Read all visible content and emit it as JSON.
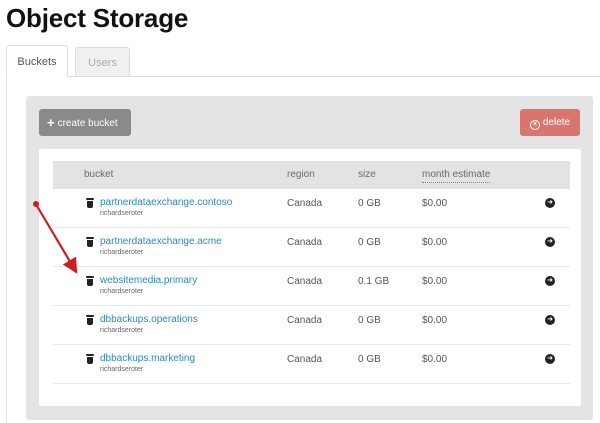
{
  "page": {
    "title": "Object Storage"
  },
  "tabs": [
    {
      "label": "Buckets",
      "active": true
    },
    {
      "label": "Users",
      "active": false
    }
  ],
  "toolbar": {
    "create_label": "create bucket",
    "create_icon": "plus-icon",
    "delete_label": "delete",
    "delete_icon": "close-circle-icon"
  },
  "table": {
    "columns": {
      "bucket": "bucket",
      "region": "region",
      "size": "size",
      "month": "month estimate"
    },
    "rows": [
      {
        "name": "partnerdataexchange.contoso",
        "owner": "richardseroter",
        "region": "Canada",
        "size": "0 GB",
        "estimate": "$0.00"
      },
      {
        "name": "partnerdataexchange.acme",
        "owner": "richardseroter",
        "region": "Canada",
        "size": "0 GB",
        "estimate": "$0.00"
      },
      {
        "name": "websitemedia.primary",
        "owner": "richardseroter",
        "region": "Canada",
        "size": "0.1 GB",
        "estimate": "$0.00"
      },
      {
        "name": "dbbackups.operations",
        "owner": "richardseroter",
        "region": "Canada",
        "size": "0 GB",
        "estimate": "$0.00"
      },
      {
        "name": "dbbackups.marketing",
        "owner": "richardseroter",
        "region": "Canada",
        "size": "0 GB",
        "estimate": "$0.00"
      }
    ]
  },
  "colors": {
    "link": "#2f86c4",
    "create_button": "#8a8a8a",
    "delete_button": "#d9756f",
    "annotation_arrow": "#cc1f1f"
  }
}
